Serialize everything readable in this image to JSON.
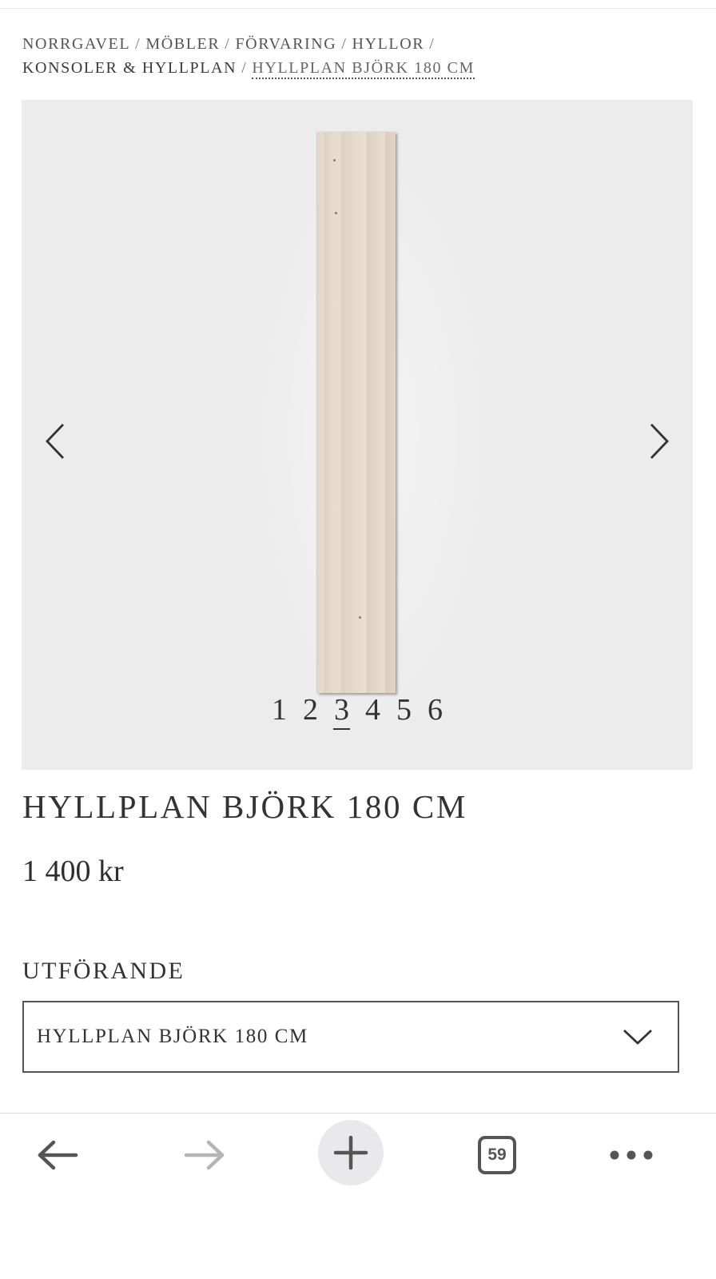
{
  "breadcrumb": {
    "items": [
      "NORRGAVEL",
      "MÖBLER",
      "FÖRVARING",
      "HYLLOR",
      "KONSOLER & HYLLPLAN"
    ],
    "separator": "/",
    "current": "HYLLPLAN BJÖRK 180 CM"
  },
  "gallery": {
    "image_alt": "Hyllplan björk",
    "pages": [
      "1",
      "2",
      "3",
      "4",
      "5",
      "6"
    ],
    "active_page": "3",
    "prev_icon": "chevron-left-icon",
    "next_icon": "chevron-right-icon"
  },
  "product": {
    "title": "HYLLPLAN BJÖRK 180 CM",
    "price": "1 400 kr",
    "variant_label": "UTFÖRANDE",
    "variant_value": "HYLLPLAN BJÖRK 180 CM"
  },
  "toolbar": {
    "tab_count": "59",
    "icons": [
      "arrow-left-icon",
      "arrow-right-icon",
      "plus-icon",
      "tabs-icon",
      "more-icon"
    ]
  },
  "colors": {
    "gallery_bg": "#ececec",
    "text": "#333333",
    "toolbar_icon": "#555555",
    "toolbar_icon_disabled": "#b5b5b5"
  }
}
